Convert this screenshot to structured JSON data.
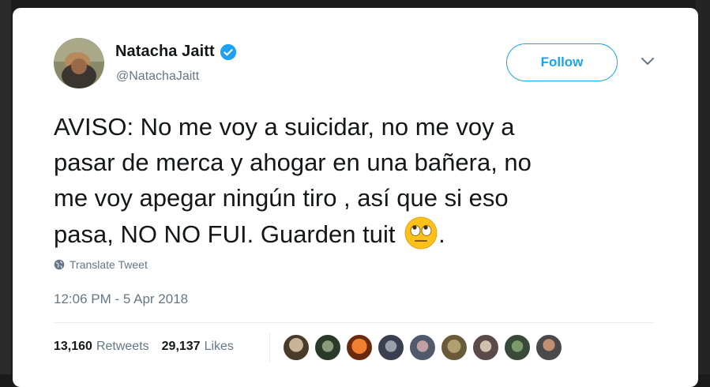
{
  "user": {
    "name": "Natacha Jaitt",
    "handle": "@NatachaJaitt",
    "verified_icon": "verified-badge-icon"
  },
  "actions": {
    "follow_label": "Follow",
    "menu_icon": "chevron-down-icon"
  },
  "tweet": {
    "text_lines": [
      "AVISO: No me voy a suicidar, no me voy a",
      "pasar de merca y ahogar en una bañera, no",
      "me voy apegar ningún tiro , así que si eso",
      "pasa, NO NO FUI. Guarden tuit"
    ],
    "trailing_punct": ".",
    "emoji": "face-with-rolling-eyes-emoji",
    "translate_label": "Translate Tweet",
    "timestamp": "12:06 PM - 5 Apr 2018"
  },
  "stats": {
    "retweets_count": "13,160",
    "retweets_label": "Retweets",
    "likes_count": "29,137",
    "likes_label": "Likes"
  },
  "likers_count": 9,
  "colors": {
    "accent": "#1da1f2",
    "text": "#14171a",
    "muted": "#657786",
    "divider": "#e6ecf0"
  }
}
